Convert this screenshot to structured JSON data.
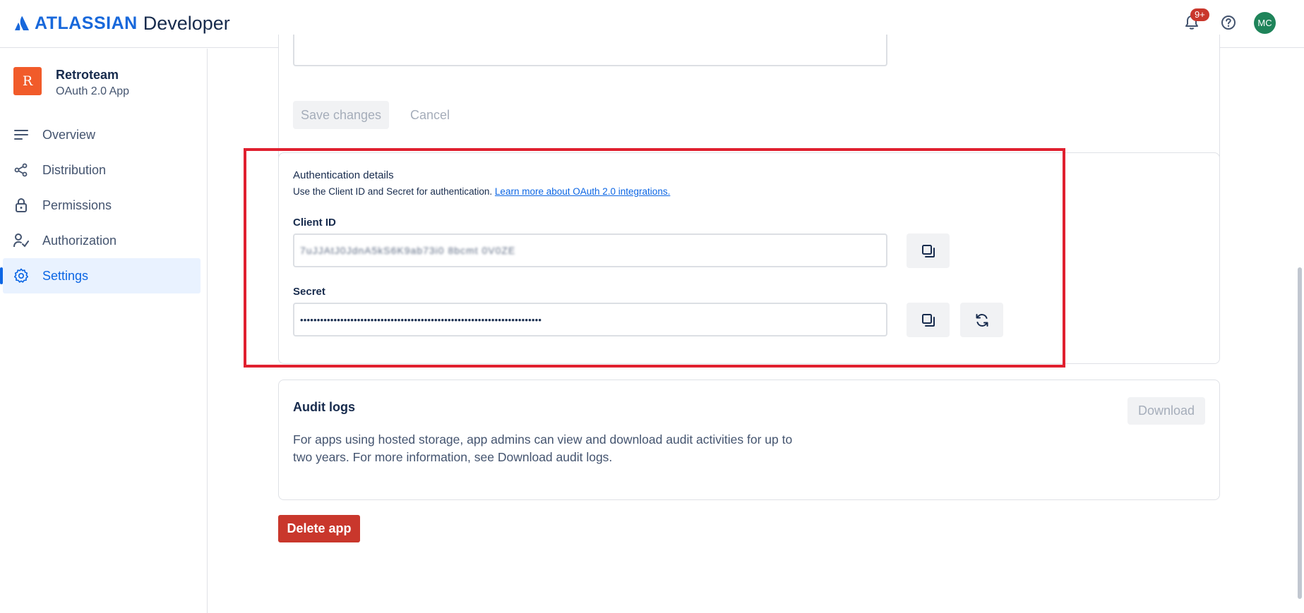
{
  "header": {
    "brand": "ATLASSIAN",
    "product": "Developer",
    "notifications_badge": "9+",
    "avatar_initials": "MC",
    "icons": [
      "atlassian-logo-icon",
      "bell-icon",
      "help-icon"
    ]
  },
  "sidebar": {
    "app_icon_letter": "R",
    "app_name": "Retroteam",
    "app_type": "OAuth 2.0 App",
    "items": [
      {
        "label": "Overview",
        "icon": "list-icon"
      },
      {
        "label": "Distribution",
        "icon": "share-icon"
      },
      {
        "label": "Permissions",
        "icon": "lock-icon"
      },
      {
        "label": "Authorization",
        "icon": "person-check-icon"
      },
      {
        "label": "Settings",
        "icon": "gear-icon",
        "active": true
      }
    ]
  },
  "top_form": {
    "save_label": "Save changes",
    "cancel_label": "Cancel"
  },
  "auth": {
    "title": "Authentication details",
    "description": "Use the Client ID and Secret for authentication.",
    "link_text": "Learn more about OAuth 2.0 integrations.",
    "client_id_label": "Client ID",
    "client_id_value": "7uJJAtJ0JdnA5kS6K9ab73i0 8bcmt 0V0ZE",
    "secret_label": "Secret",
    "secret_value": "••••••••••••••••••••••••••••••••••••••••••••••••••••••••••••••••••••••••"
  },
  "audit": {
    "title": "Audit logs",
    "description": "For apps using hosted storage, app admins can view and download audit activities for up to two years. For more information, see Download audit logs.",
    "download_label": "Download"
  },
  "delete_label": "Delete app",
  "colors": {
    "accent": "#0c66e4",
    "brand": "#1868db",
    "danger": "#c9372c",
    "highlight": "#e0202f",
    "app_icon": "#f15b2a",
    "avatar": "#1f845a"
  }
}
